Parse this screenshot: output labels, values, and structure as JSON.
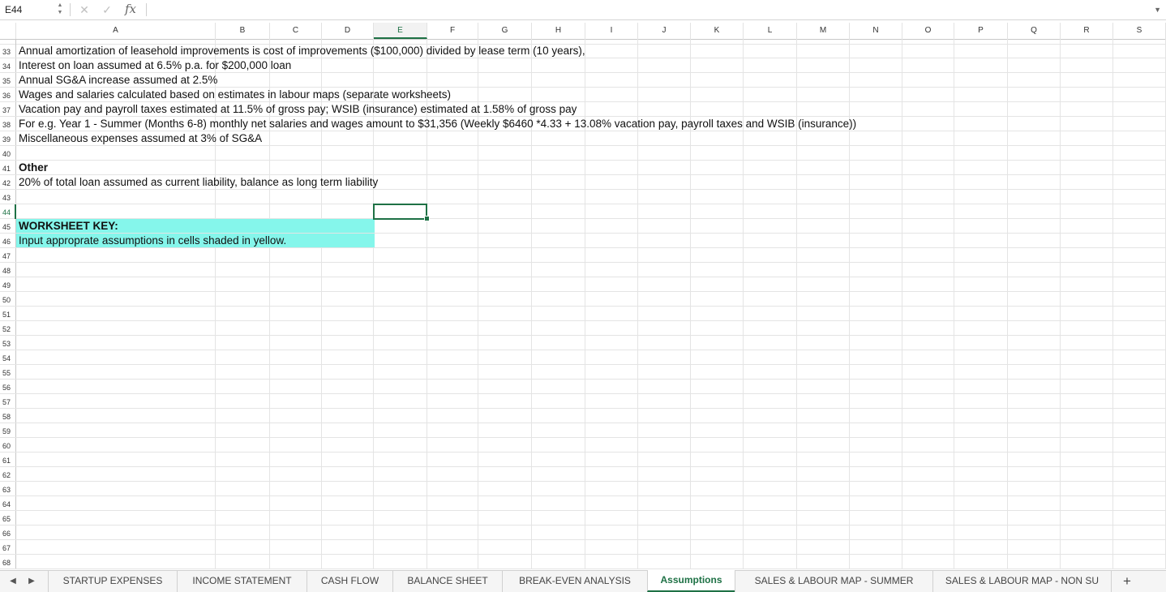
{
  "formula_bar": {
    "cell_ref": "E44",
    "cancel_symbol": "✕",
    "confirm_symbol": "✓",
    "fx_label": "fx",
    "content": ""
  },
  "columns": [
    "A",
    "B",
    "C",
    "D",
    "E",
    "F",
    "G",
    "H",
    "I",
    "J",
    "K",
    "L",
    "M",
    "N",
    "O",
    "P",
    "Q",
    "R",
    "S"
  ],
  "active_column": "E",
  "rows": [
    {
      "num": "33",
      "text": "Annual amortization of leasehold improvements is cost of improvements ($100,000) divided by lease term (10 years),",
      "bold": false
    },
    {
      "num": "34",
      "text": "Interest on loan assumed at 6.5% p.a. for $200,000 loan",
      "bold": false
    },
    {
      "num": "35",
      "text": "Annual SG&A increase assumed at 2.5%",
      "bold": false
    },
    {
      "num": "36",
      "text": "Wages and salaries calculated based on estimates in labour maps (separate worksheets)",
      "bold": false
    },
    {
      "num": "37",
      "text": "Vacation pay and payroll taxes estimated at 11.5% of gross pay; WSIB (insurance) estimated at 1.58% of gross pay",
      "bold": false
    },
    {
      "num": "38",
      "text": "For e.g. Year 1 - Summer (Months 6-8) monthly net salaries and wages amount to $31,356 (Weekly $6460 *4.33 + 13.08% vacation pay, payroll taxes and WSIB (insurance))",
      "bold": false
    },
    {
      "num": "39",
      "text": "Miscellaneous expenses assumed at 3% of SG&A",
      "bold": false
    },
    {
      "num": "40",
      "text": "",
      "bold": false
    },
    {
      "num": "41",
      "text": "Other",
      "bold": true
    },
    {
      "num": "42",
      "text": "20% of total loan assumed as current liability, balance as long term liability",
      "bold": false
    },
    {
      "num": "43",
      "text": "",
      "bold": false
    },
    {
      "num": "44",
      "text": "",
      "bold": false
    },
    {
      "num": "45",
      "text": "WORKSHEET KEY:",
      "bold": true
    },
    {
      "num": "46",
      "text": "Input approprate assumptions in cells shaded in yellow.",
      "bold": false
    },
    {
      "num": "47",
      "text": "",
      "bold": false
    },
    {
      "num": "48",
      "text": "",
      "bold": false
    },
    {
      "num": "49",
      "text": "",
      "bold": false
    },
    {
      "num": "50",
      "text": "",
      "bold": false
    },
    {
      "num": "51",
      "text": "",
      "bold": false
    },
    {
      "num": "52",
      "text": "",
      "bold": false
    },
    {
      "num": "53",
      "text": "",
      "bold": false
    },
    {
      "num": "54",
      "text": "",
      "bold": false
    },
    {
      "num": "55",
      "text": "",
      "bold": false
    },
    {
      "num": "56",
      "text": "",
      "bold": false
    },
    {
      "num": "57",
      "text": "",
      "bold": false
    },
    {
      "num": "58",
      "text": "",
      "bold": false
    },
    {
      "num": "59",
      "text": "",
      "bold": false
    },
    {
      "num": "60",
      "text": "",
      "bold": false
    },
    {
      "num": "61",
      "text": "",
      "bold": false
    },
    {
      "num": "62",
      "text": "",
      "bold": false
    },
    {
      "num": "63",
      "text": "",
      "bold": false
    },
    {
      "num": "64",
      "text": "",
      "bold": false
    },
    {
      "num": "65",
      "text": "",
      "bold": false
    },
    {
      "num": "66",
      "text": "",
      "bold": false
    },
    {
      "num": "67",
      "text": "",
      "bold": false
    },
    {
      "num": "68",
      "text": "",
      "bold": false
    }
  ],
  "active_row": "44",
  "highlight_color": "#85f6eb",
  "accent_color": "#1e7145",
  "sheet_tabs": [
    {
      "label": "STARTUP EXPENSES",
      "active": false
    },
    {
      "label": "INCOME STATEMENT",
      "active": false
    },
    {
      "label": "CASH FLOW",
      "active": false
    },
    {
      "label": "BALANCE SHEET",
      "active": false
    },
    {
      "label": "BREAK-EVEN ANALYSIS",
      "active": false
    },
    {
      "label": "Assumptions",
      "active": true
    },
    {
      "label": "SALES & LABOUR MAP - SUMMER",
      "active": false
    },
    {
      "label": "SALES & LABOUR MAP - NON SU",
      "active": false
    }
  ],
  "tab_nav": {
    "prev": "◀",
    "next": "▶",
    "add": "+"
  }
}
